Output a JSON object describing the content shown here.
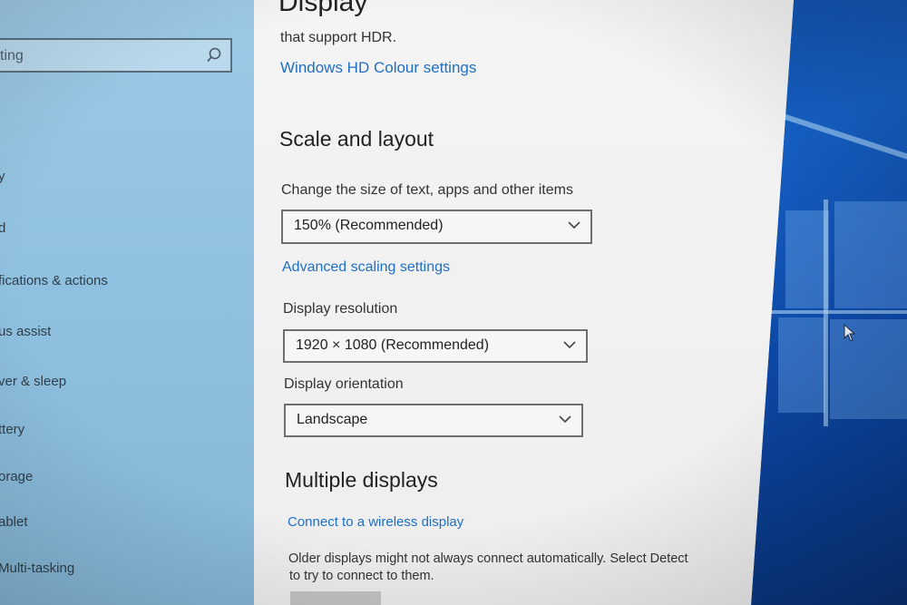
{
  "window": {
    "page_title": "Display"
  },
  "sidebar": {
    "search_placeholder": "ting",
    "items": [
      {
        "label": "y"
      },
      {
        "label": "d"
      },
      {
        "label": "fications & actions"
      },
      {
        "label": "us assist"
      },
      {
        "label": "ver & sleep"
      },
      {
        "label": "ttery"
      },
      {
        "label": "orage"
      },
      {
        "label": "ablet"
      },
      {
        "label": "Multi-tasking"
      }
    ]
  },
  "hdr": {
    "description_tail": "that support HDR.",
    "link": "Windows HD Colour settings"
  },
  "scale_layout": {
    "title": "Scale and layout",
    "size_label": "Change the size of text, apps and other items",
    "size_value": "150% (Recommended)",
    "advanced_link": "Advanced scaling settings",
    "resolution_label": "Display resolution",
    "resolution_value": "1920 × 1080 (Recommended)",
    "orientation_label": "Display orientation",
    "orientation_value": "Landscape"
  },
  "multiple_displays": {
    "title": "Multiple displays",
    "wireless_link": "Connect to a wireless display",
    "detect_text_line1": "Older displays might not always connect automatically. Select Detect",
    "detect_text_line2": "to try to connect to them."
  },
  "icons": {
    "search": "search-icon",
    "chevron": "chevron-down-icon",
    "cursor": "mouse-pointer-icon"
  },
  "colors": {
    "link": "#1f6fc4",
    "sidebar": "#93c3e1",
    "wallpaper": "#1560c4"
  }
}
